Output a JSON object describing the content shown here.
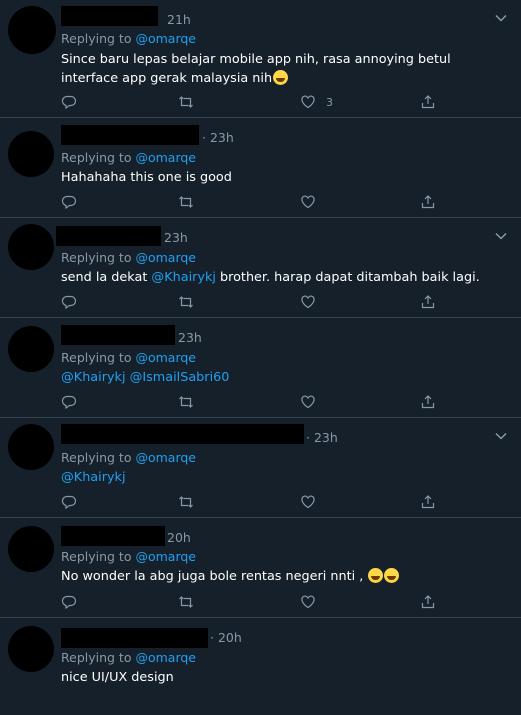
{
  "tweets": [
    {
      "time": "21h",
      "replying_prefix": "Replying to",
      "handle": "@omarqe",
      "text": "Since baru lepas belajar mobile app nih, rasa annoying betul interface app gerak malaysia nih",
      "emoji": "face-with-tears-of-joy",
      "likes": "3"
    },
    {
      "time": "· 23h",
      "replying_prefix": "Replying to",
      "handle": "@omarqe",
      "text": "Hahahaha this one is good"
    },
    {
      "time": "23h",
      "replying_prefix": "Replying to",
      "handle": "@omarqe",
      "text_before": "send la dekat ",
      "mention": "@Khairykj",
      "text_after": " brother. harap dapat ditambah baik lagi."
    },
    {
      "time": "23h",
      "replying_prefix": "Replying to",
      "handle": "@omarqe",
      "mentions": "@Khairykj @IsmailSabri60"
    },
    {
      "time": "· 23h",
      "replying_prefix": "Replying to",
      "handle": "@omarqe",
      "mentions": "@Khairykj"
    },
    {
      "time": "20h",
      "replying_prefix": "Replying to",
      "handle": "@omarqe",
      "text": "No wonder la abg juga bole rentas negeri nnti ,",
      "emoji": "grinning-face"
    },
    {
      "time": "· 20h",
      "replying_prefix": "Replying to",
      "handle": "@omarqe",
      "text": "nice UI/UX design"
    }
  ],
  "colors": {
    "background": "#15202b",
    "divider": "#38444d",
    "muted": "#8899a6",
    "link": "#1da1f2"
  }
}
